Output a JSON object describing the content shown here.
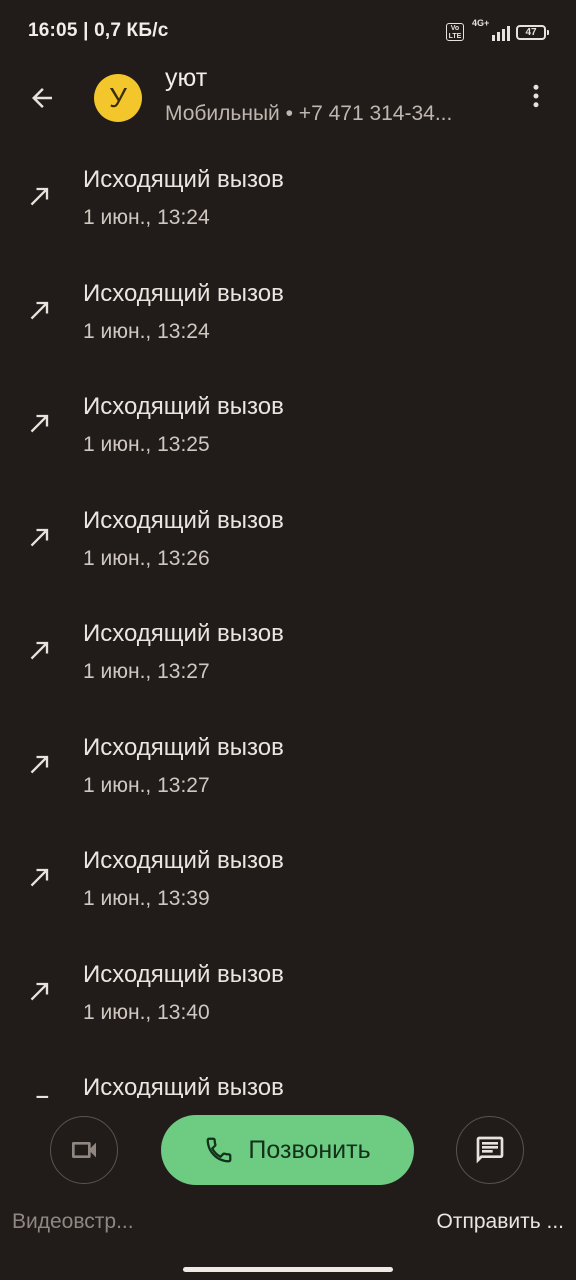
{
  "status_bar": {
    "time_speed": "16:05 | 0,7 КБ/с",
    "volte_label": "Vo LTE",
    "network_label": "4G+",
    "battery_level": "47"
  },
  "header": {
    "back_icon": "arrow-back-icon",
    "avatar_letter": "У",
    "contact_name": "уют",
    "contact_sub": "Мобильный • +7 471 314-34...",
    "menu_icon": "more-vertical-icon"
  },
  "calls": [
    {
      "type": "Исходящий вызов",
      "time": "1 июн., 13:24"
    },
    {
      "type": "Исходящий вызов",
      "time": "1 июн., 13:24"
    },
    {
      "type": "Исходящий вызов",
      "time": "1 июн., 13:25"
    },
    {
      "type": "Исходящий вызов",
      "time": "1 июн., 13:26"
    },
    {
      "type": "Исходящий вызов",
      "time": "1 июн., 13:27"
    },
    {
      "type": "Исходящий вызов",
      "time": "1 июн., 13:27"
    },
    {
      "type": "Исходящий вызов",
      "time": "1 июн., 13:39"
    },
    {
      "type": "Исходящий вызов",
      "time": "1 июн., 13:40"
    },
    {
      "type": "Исходящий вызов",
      "time": ""
    }
  ],
  "actions": {
    "video_label": "Видеовстр...",
    "call_label": "Позвонить",
    "message_label": "Отправить ..."
  },
  "colors": {
    "background": "#211c1a",
    "call_button": "#6dcb82",
    "avatar": "#f3c62c"
  }
}
